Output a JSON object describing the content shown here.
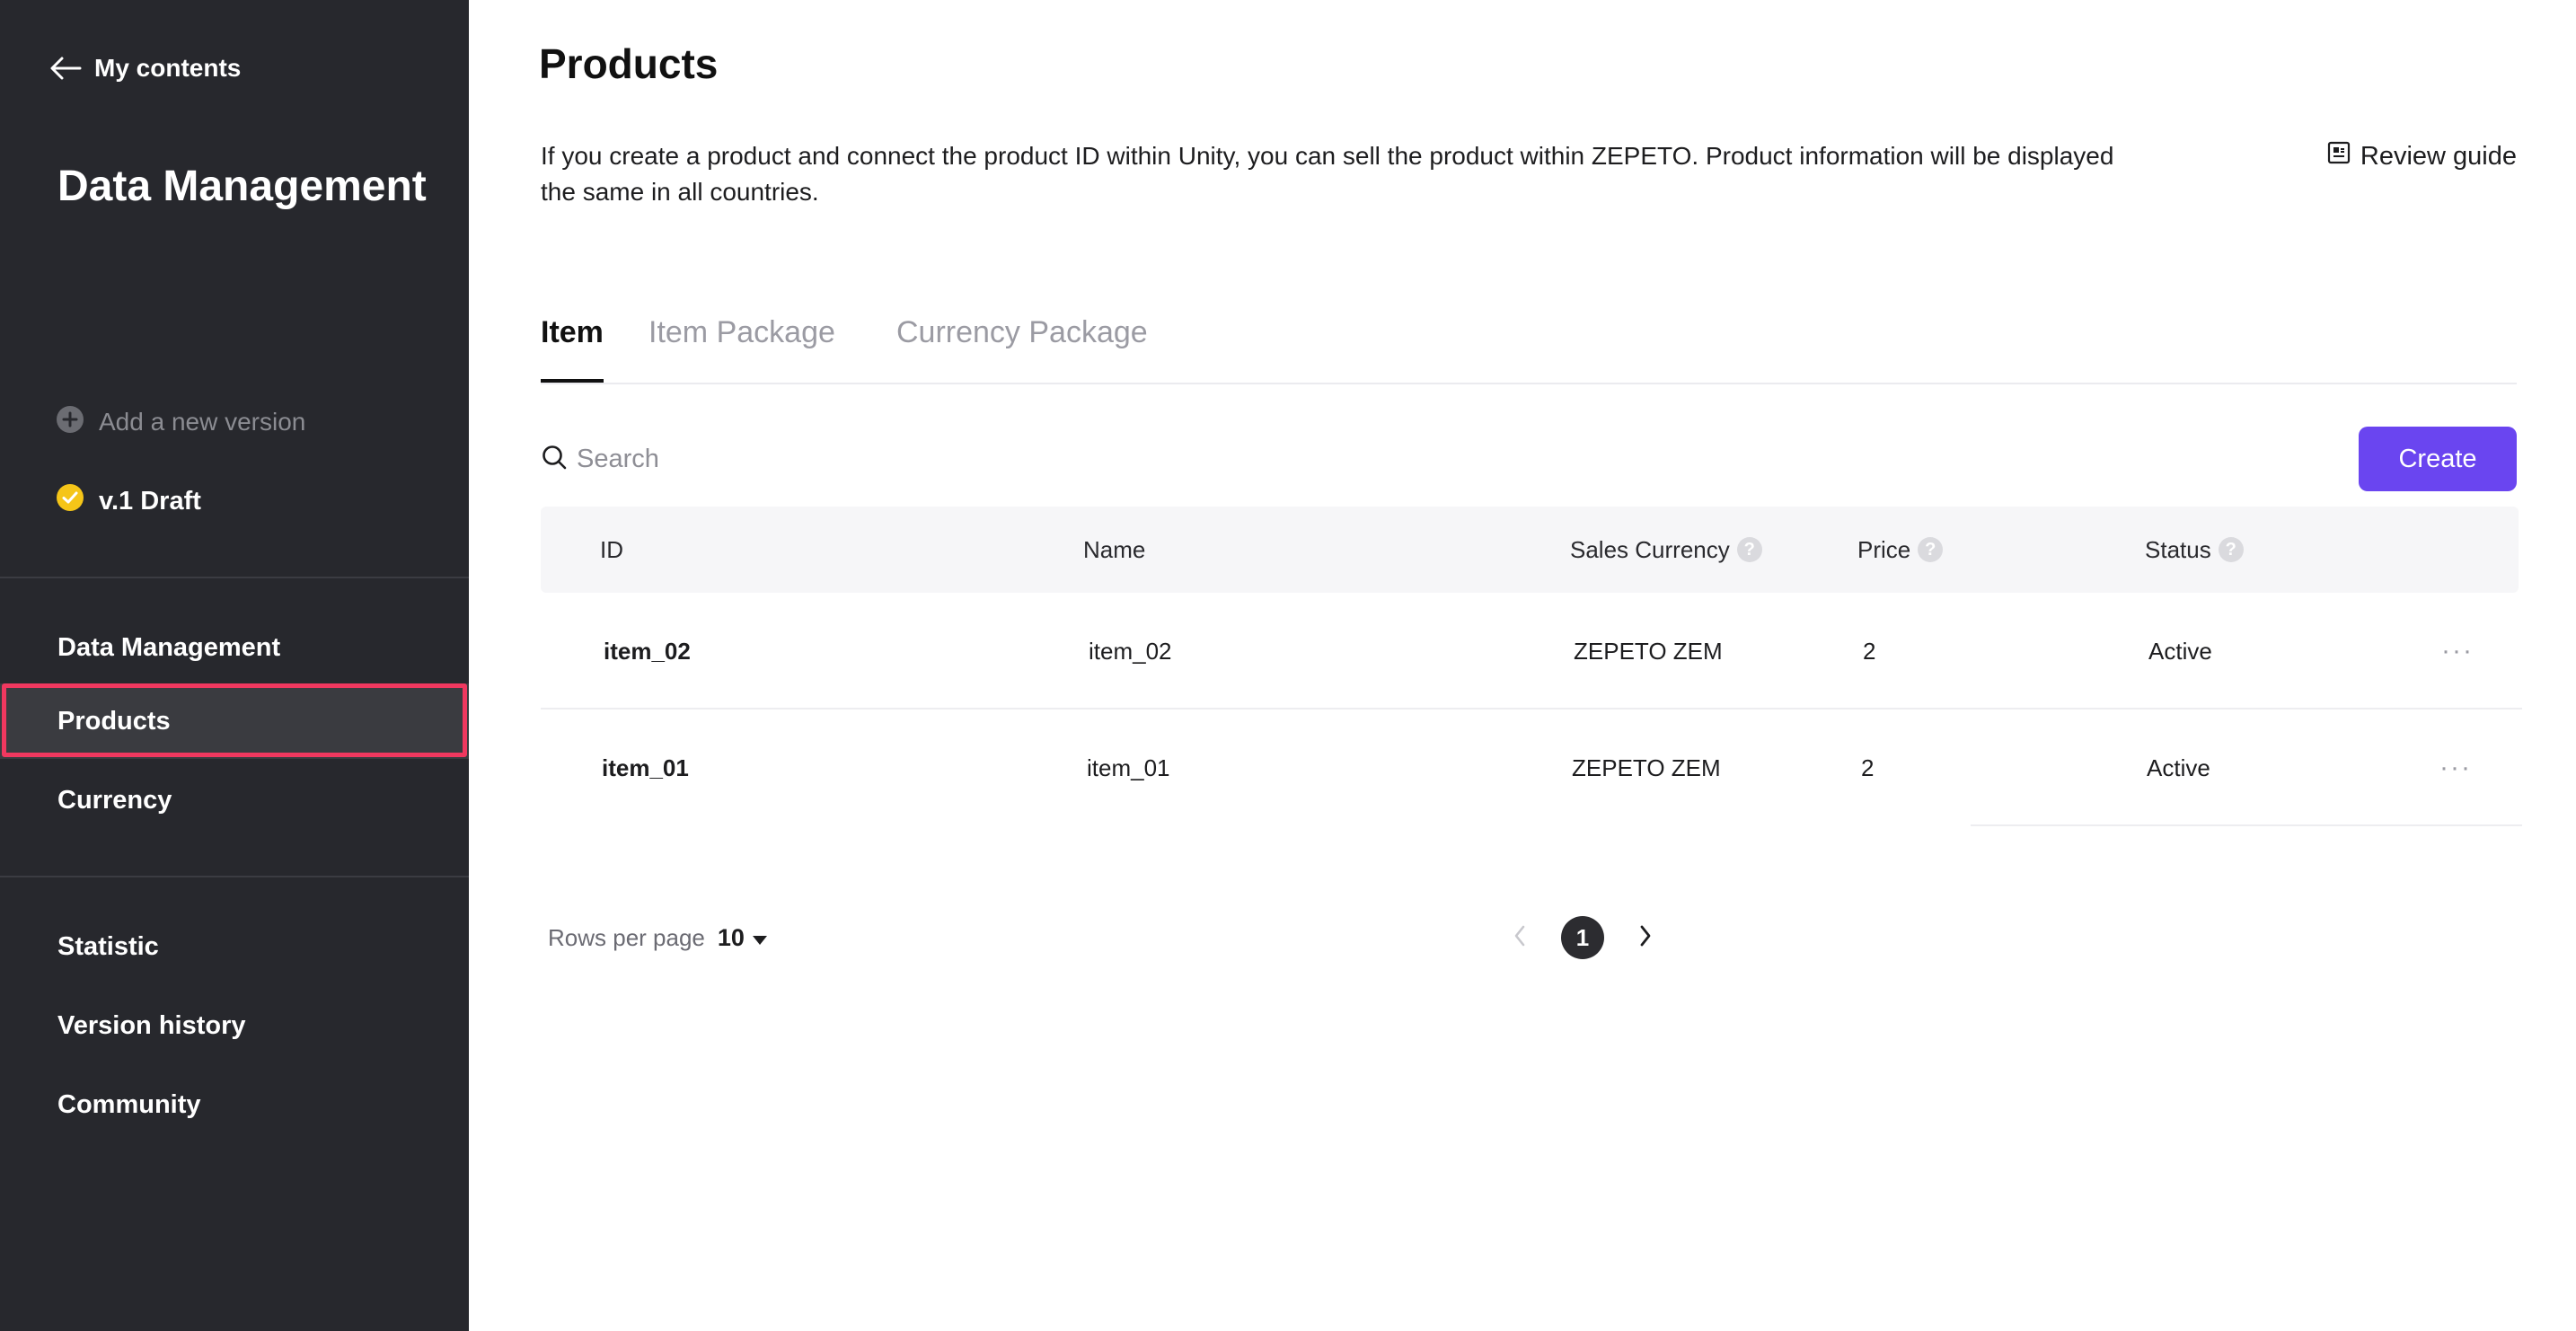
{
  "sidebar": {
    "back_label": "My contents",
    "title": "Data Management",
    "add_version_label": "Add a new version",
    "version_label": "v.1 Draft",
    "nav_group_1": [
      {
        "label": "Data Management",
        "active": false
      },
      {
        "label": "Products",
        "active": true
      },
      {
        "label": "Currency",
        "active": false
      }
    ],
    "nav_group_2": [
      {
        "label": "Statistic"
      },
      {
        "label": "Version history"
      },
      {
        "label": "Community"
      }
    ],
    "colors": {
      "background": "#27282d",
      "active_item": "#3a3b40",
      "highlight": "#f0385f",
      "version_badge": "#f5c518"
    }
  },
  "main": {
    "title": "Products",
    "description": "If you create a product and connect the product ID within Unity, you can sell the product within ZEPETO. Product information will be displayed the same in all countries.",
    "review_guide_label": "Review guide",
    "tabs": [
      {
        "label": "Item",
        "active": true
      },
      {
        "label": "Item Package",
        "active": false
      },
      {
        "label": "Currency Package",
        "active": false
      }
    ],
    "search_placeholder": "Search",
    "create_label": "Create",
    "accent_color": "#6a45f0",
    "table": {
      "columns": [
        "ID",
        "Name",
        "Sales Currency",
        "Price",
        "Status"
      ],
      "rows": [
        {
          "id": "item_02",
          "name": "item_02",
          "currency": "ZEPETO ZEM",
          "price": "2",
          "status": "Active"
        },
        {
          "id": "item_01",
          "name": "item_01",
          "currency": "ZEPETO ZEM",
          "price": "2",
          "status": "Active"
        }
      ]
    },
    "pagination": {
      "rows_per_page_label": "Rows per page",
      "rows_per_page_value": "10",
      "current_page": "1"
    }
  },
  "icons": {
    "back": "arrow-left-icon",
    "add": "plus-circle-icon",
    "version": "check-circle-icon",
    "review": "document-icon",
    "search": "search-icon",
    "help": "question-circle-icon",
    "more": "more-horizontal-icon",
    "dropdown": "caret-down-icon",
    "prev": "chevron-left-icon",
    "next": "chevron-right-icon"
  }
}
